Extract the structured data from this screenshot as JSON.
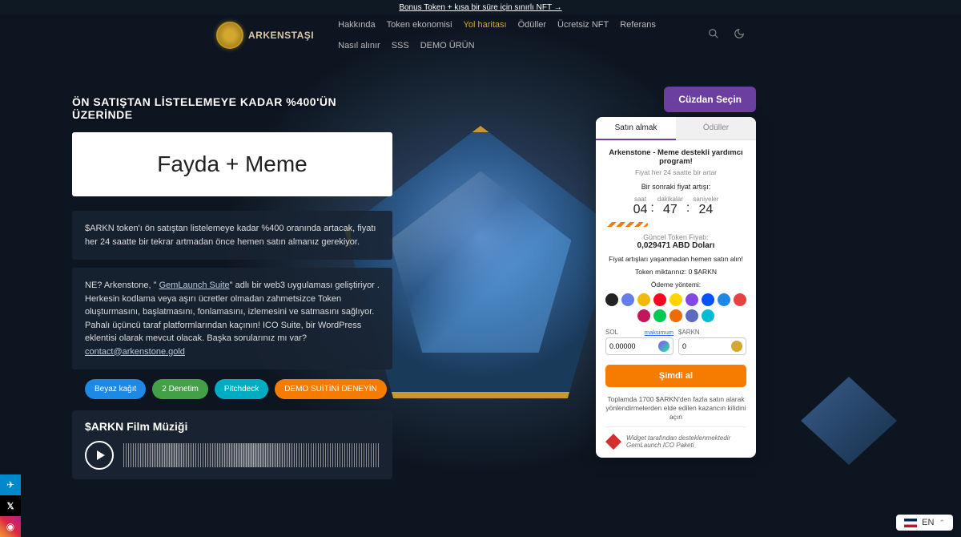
{
  "topBanner": "Bonus Token + kısa bir süre için sınırlı NFT →",
  "brand": "ARKENSTAŞI",
  "nav": {
    "hakkinda": "Hakkında",
    "token": "Token ekonomisi",
    "yol": "Yol haritası",
    "oduller": "Ödüller",
    "nft": "Ücretsiz NFT",
    "referans": "Referans",
    "nasil": "Nasıl alınır",
    "sss": "SSS",
    "demo": "DEMO ÜRÜN"
  },
  "tagline": "ÖN SATIŞTAN LİSTELEMEYE KADAR %400'ÜN ÜZERİNDE",
  "headline": "Fayda + Meme",
  "desc1": "$ARKN token'ı ön satıştan listelemeye kadar %400 oranında artacak, fiyatı her 24 saatte bir tekrar artmadan önce hemen satın almanız gerekiyor.",
  "desc2Prefix": "NE? Arkenstone, \" ",
  "desc2Link1": "GemLaunch Suite",
  "desc2Body": "\" adlı bir web3 uygulaması geliştiriyor . Herkesin kodlama veya aşırı ücretler olmadan zahmetsizce Token oluşturmasını, başlatmasını, fonlamasını, izlemesini ve satmasını sağlıyor. Pahalı üçüncü taraf platformlarından kaçının! ICO Suite, bir WordPress eklentisi olarak mevcut olacak. Başka sorularınız mı var? ",
  "desc2Email": "contact@arkenstone.gold",
  "buttons": {
    "whitepaper": "Beyaz kağıt",
    "audit": "2 Denetim",
    "pitch": "Pitchdeck",
    "demo": "DEMO SUİTİNİ DENEYİN"
  },
  "audioTitle": "$ARKN Film Müziği",
  "walletBtn": "Cüzdan Seçin",
  "widget": {
    "tab1": "Satın almak",
    "tab2": "Ödüller",
    "title": "Arkenstone - Meme destekli yardımcı program!",
    "subtitle": "Fiyat her 24 saatte bir artar",
    "nextPrice": "Bir sonraki fiyat artışı:",
    "cd": {
      "hLabel": "saat",
      "h": "04",
      "mLabel": "dakikalar",
      "m": "47",
      "sLabel": "saniyeler",
      "s": "24"
    },
    "currentPriceLabel": "Güncel Token Fiyatı:",
    "currentPrice": "0,029471 ABD Doları",
    "buyNow": "Fiyat artışları yaşanmadan hemen satın alın!",
    "yourTokens": "Token miktarınız: 0 $ARKN",
    "payMethod": "Ödeme yöntemi:",
    "solLabel": "SOL",
    "solVal": "0.00000",
    "maxLabel": "maksimum",
    "arknLabel": "$ARKN",
    "arknVal": "0",
    "buyBtn": "Şimdi al",
    "unlock": "Toplamda 1700 $ARKN'den fazla satın alarak yönlendirmelerden elde edilen kazancın kilidini açın",
    "footer1": "Widget tarafından desteklenmektedir",
    "footer2": "GemLaunch ICO Paketi"
  },
  "lang": "EN",
  "payColors": [
    "#222",
    "#627eea",
    "#f0b90b",
    "#ff0420",
    "#ffd400",
    "#8247e5",
    "#0052ff",
    "#1e88e5",
    "#e84142",
    "#c2185b",
    "#00c853",
    "#ef6c00",
    "#5c6bc0",
    "#00bcd4"
  ]
}
